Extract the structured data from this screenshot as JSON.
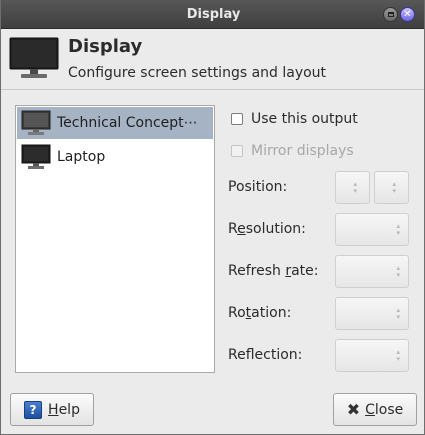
{
  "window": {
    "title": "Display"
  },
  "header": {
    "title": "Display",
    "subtitle": "Configure screen settings and layout",
    "icon": "monitor-icon"
  },
  "outputs": [
    {
      "label": "Technical Concept⋯",
      "selected": true,
      "icon": "monitor-icon"
    },
    {
      "label": "Laptop",
      "selected": false,
      "icon": "monitor-icon"
    }
  ],
  "options": {
    "use_output": {
      "label": "Use this output",
      "checked": false,
      "enabled": true
    },
    "mirror": {
      "label": "Mirror displays",
      "checked": false,
      "enabled": false
    }
  },
  "properties": {
    "position": {
      "label_pre": "Position:",
      "accel": "",
      "label_post": ""
    },
    "resolution": {
      "label_pre": "R",
      "accel": "e",
      "label_post": "solution:"
    },
    "refresh": {
      "label_pre": "Refresh ",
      "accel": "r",
      "label_post": "ate:"
    },
    "rotation": {
      "label_pre": "Ro",
      "accel": "t",
      "label_post": "ation:"
    },
    "reflection": {
      "label_pre": "Ref",
      "accel": "l",
      "label_post": "ection:"
    }
  },
  "buttons": {
    "help": {
      "accel": "H",
      "rest": "elp",
      "icon": "help-icon"
    },
    "close": {
      "accel": "C",
      "rest": "lose",
      "icon": "close-icon"
    }
  },
  "colors": {
    "titlebar": "#4a4a4a",
    "selection": "#a6b3c5",
    "close_button": "#7a6fe6"
  }
}
